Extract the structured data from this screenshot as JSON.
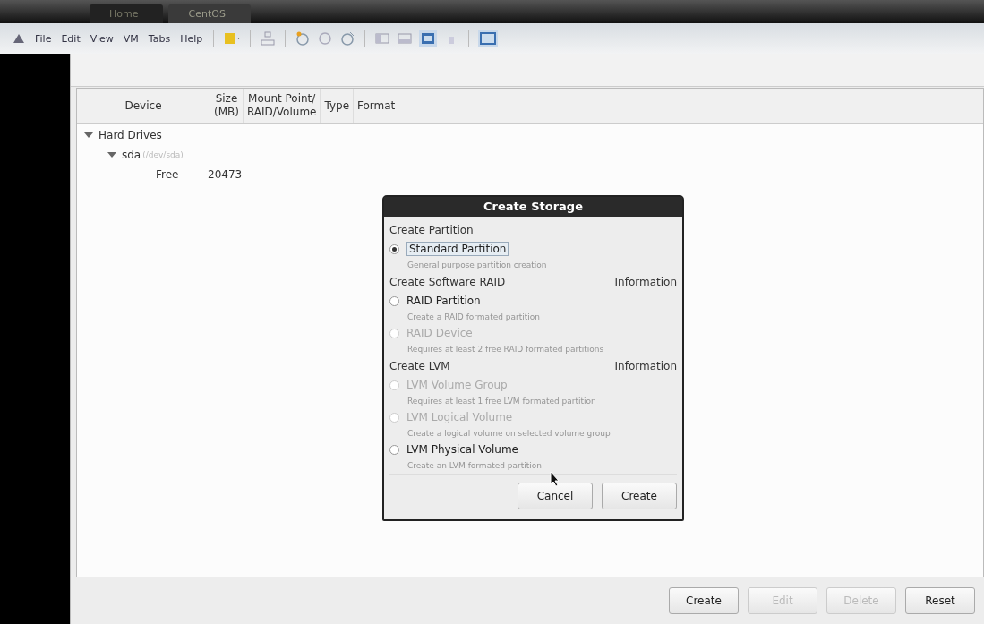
{
  "vm_tabs": [
    {
      "label": "Home",
      "selected": false
    },
    {
      "label": "CentOS",
      "selected": true
    }
  ],
  "menu": [
    "File",
    "Edit",
    "View",
    "VM",
    "Tabs",
    "Help"
  ],
  "table": {
    "columns": [
      "Device",
      "Size\n(MB)",
      "Mount Point/\nRAID/Volume",
      "Type",
      "Format"
    ],
    "rows": [
      {
        "device": "Hard Drives",
        "expanded": true,
        "children": [
          {
            "device": "sda",
            "path": "(/dev/sda)",
            "expanded": true,
            "children": [
              {
                "device": "Free",
                "size": "20473"
              }
            ]
          }
        ]
      }
    ]
  },
  "dialog": {
    "title": "Create Storage",
    "sections": [
      {
        "title": "Create Partition",
        "options": [
          {
            "label": "Standard Partition",
            "description": "General purpose partition creation",
            "selected": true,
            "disabled": false
          }
        ]
      },
      {
        "title": "Create Software RAID",
        "info": "Information",
        "options": [
          {
            "label": "RAID Partition",
            "description": "Create a RAID formated partition",
            "selected": false,
            "disabled": false
          },
          {
            "label": "RAID Device",
            "description": "Requires at least 2 free RAID formated partitions",
            "selected": false,
            "disabled": true
          }
        ]
      },
      {
        "title": "Create LVM",
        "info": "Information",
        "options": [
          {
            "label": "LVM Volume Group",
            "description": "Requires at least 1 free LVM formated partition",
            "selected": false,
            "disabled": true
          },
          {
            "label": "LVM Logical Volume",
            "description": "Create a logical volume on selected volume group",
            "selected": false,
            "disabled": true
          },
          {
            "label": "LVM Physical Volume",
            "description": "Create an LVM formated partition",
            "selected": false,
            "disabled": false
          }
        ]
      }
    ],
    "buttons": [
      "Cancel",
      "Create"
    ]
  },
  "buttons": [
    {
      "label": "Create",
      "disabled": false
    },
    {
      "label": "Edit",
      "disabled": true
    },
    {
      "label": "Delete",
      "disabled": true
    },
    {
      "label": "Reset",
      "disabled": false
    }
  ]
}
